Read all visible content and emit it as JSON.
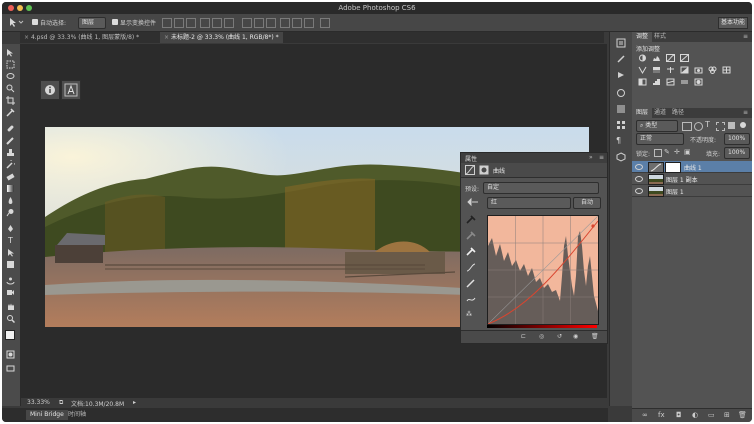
{
  "window": {
    "title": "Adobe Photoshop CS6"
  },
  "options_bar": {
    "auto_select_label": "自动选择:",
    "auto_select_value": "图层",
    "show_transform_label": "显示变换控件",
    "workspace_label": "基本功能"
  },
  "doc_tabs": [
    {
      "label": "4.psd @ 33.3% (曲线 1, 图层蒙版/8) *",
      "active": false
    },
    {
      "label": "未标题-2 @ 33.3% (曲线 1, RGB/8*) *",
      "active": true
    }
  ],
  "properties_panel": {
    "title": "属性",
    "type_label": "曲线",
    "preset_label": "预设:",
    "preset_value": "自定",
    "channel_value": "红",
    "auto_button": "自动"
  },
  "adjustments_panel": {
    "tabs": [
      "调整",
      "样式"
    ],
    "add_label": "添加调整"
  },
  "layers_panel": {
    "tabs": [
      "图层",
      "通道",
      "路径"
    ],
    "filter_label": "类型",
    "blend_mode": "正常",
    "opacity_label": "不透明度:",
    "opacity_value": "100%",
    "lock_label": "锁定:",
    "fill_label": "填充:",
    "fill_value": "100%",
    "layers": [
      {
        "name": "曲线 1",
        "selected": true
      },
      {
        "name": "图层 1 副本",
        "selected": false
      },
      {
        "name": "图层 1",
        "selected": false
      }
    ]
  },
  "status_bar": {
    "zoom": "33.33%",
    "doc_info": "文档:10.3M/20.8M"
  },
  "bottom_tabs": [
    {
      "label": "Mini Bridge",
      "active": true
    },
    {
      "label": "时间轴",
      "active": false
    }
  ],
  "colors": {
    "accent": "#5b7fa8",
    "curve_fill": "#f2b79c",
    "curve_line": "#d9452f"
  }
}
